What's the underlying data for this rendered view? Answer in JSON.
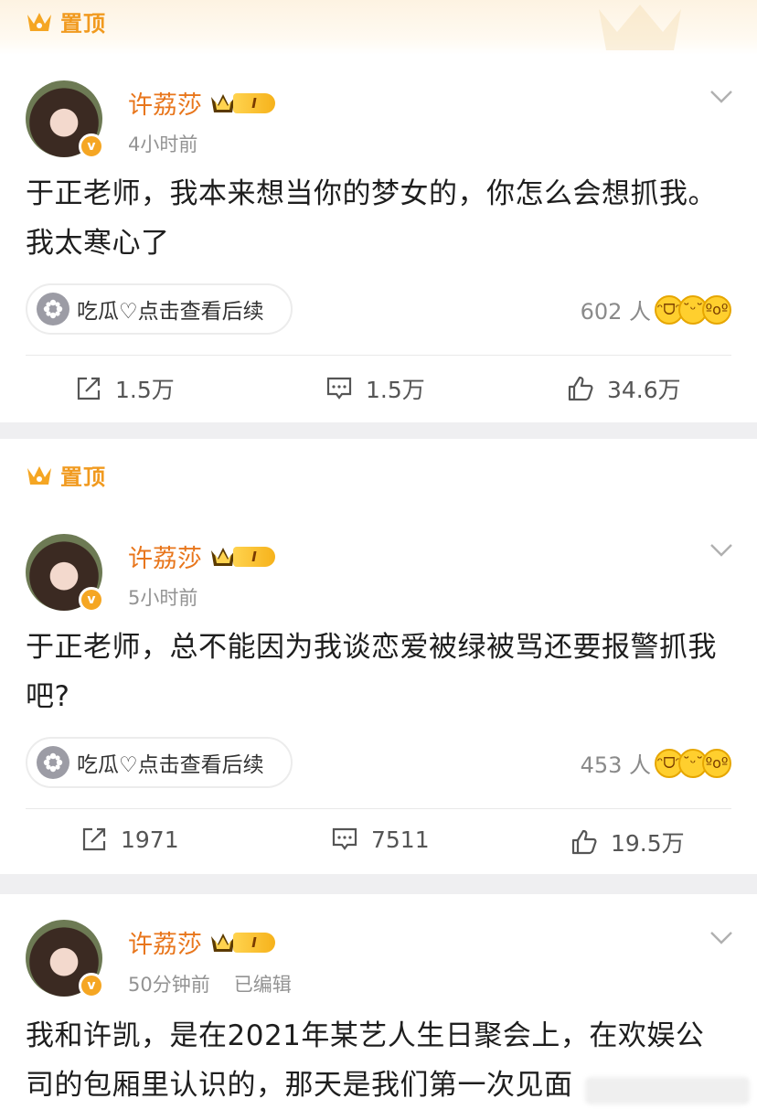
{
  "pin_label": "置顶",
  "posts": [
    {
      "username": "许荔莎",
      "vip_level": "I",
      "time": "4小时前",
      "edited": "",
      "content": "于正老师，我本来想当你的梦女的，你怎么会想抓我。我太寒心了",
      "topic": "吃瓜♡点击查看后续",
      "reaction_count": "602 人",
      "share": "1.5万",
      "comment": "1.5万",
      "like": "34.6万"
    },
    {
      "username": "许荔莎",
      "vip_level": "I",
      "time": "5小时前",
      "edited": "",
      "content": "于正老师，总不能因为我谈恋爱被绿被骂还要报警抓我吧?",
      "topic": "吃瓜♡点击查看后续",
      "reaction_count": "453 人",
      "share": "1971",
      "comment": "7511",
      "like": "19.5万"
    },
    {
      "username": "许荔莎",
      "vip_level": "I",
      "time": "50分钟前",
      "edited": "已编辑",
      "content": "我和许凯，是在2021年某艺人生日聚会上，在欢娱公司的包厢里认识的，那天是我们第一次见面"
    }
  ],
  "colors": {
    "username": "#e8761c",
    "pin": "#f19a1f",
    "separator": "#efeff1"
  }
}
